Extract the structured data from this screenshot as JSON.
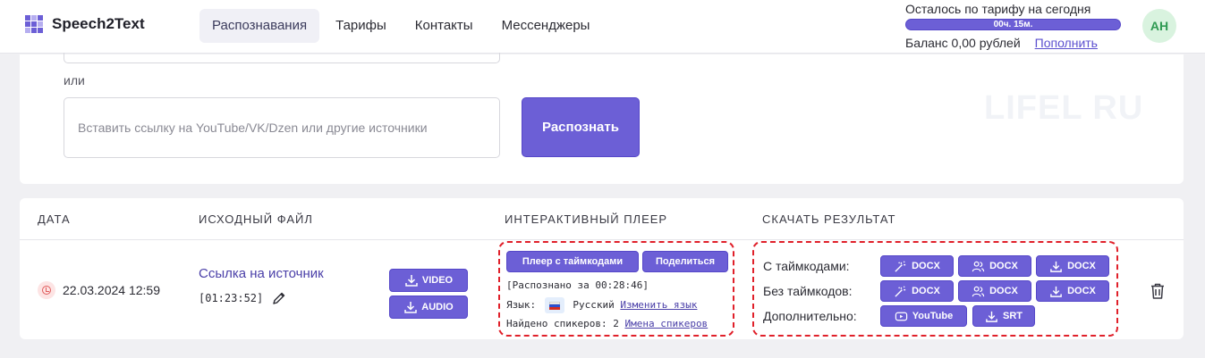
{
  "header": {
    "logo_text": "Speech2Text",
    "nav": [
      {
        "label": "Распознавания",
        "active": true
      },
      {
        "label": "Тарифы",
        "active": false
      },
      {
        "label": "Контакты",
        "active": false
      },
      {
        "label": "Мессенджеры",
        "active": false
      }
    ],
    "tariff_label": "Осталось по тарифу на сегодня",
    "tariff_remaining": "00ч. 15м.",
    "balance_text": "Баланс 0,00 рублей",
    "topup_link": "Пополнить",
    "avatar_initials": "AH"
  },
  "upload": {
    "or_label": "или",
    "url_placeholder": "Вставить ссылку на YouTube/VK/Dzen или другие источники",
    "recognize_label": "Распознать"
  },
  "watermark": "LIFEL RU",
  "table": {
    "headers": [
      "ДАТА",
      "ИСХОДНЫЙ ФАЙЛ",
      "ИНТЕРАКТИВНЫЙ ПЛЕЕР",
      "СКАЧАТЬ РЕЗУЛЬТАТ"
    ],
    "row": {
      "date": "22.03.2024 12:59",
      "source_link": "Ссылка на источник",
      "duration": "[01:23:52]",
      "video_label": "VIDEO",
      "audio_label": "AUDIO",
      "player": {
        "timecodes_btn": "Плеер с таймкодами",
        "share_btn": "Поделиться",
        "recognized_in": "[Распознано за 00:28:46]",
        "language_label": "Язык:",
        "language_value": "Русский",
        "change_language": "Изменить язык",
        "speakers_text": "Найдено спикеров: 2",
        "speaker_names": "Имена спикеров"
      },
      "results": {
        "with_timecodes": "С таймкодами:",
        "without_timecodes": "Без таймкодов:",
        "additional": "Дополнительно:",
        "docx": "DOCX",
        "youtube": "YouTube",
        "srt": "SRT"
      }
    }
  },
  "colors": {
    "accent": "#6c5fd6",
    "highlight": "#e0202a"
  }
}
